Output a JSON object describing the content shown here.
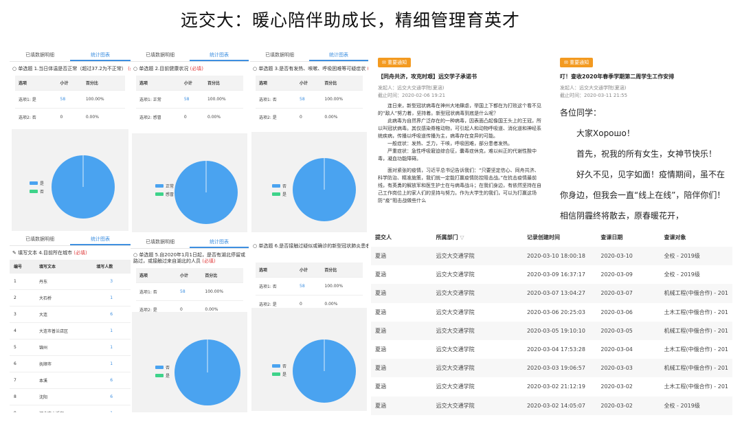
{
  "title": "远交大：暖心陪伴助成长，精细管理育英才",
  "tabs": {
    "detail": "已填数据明细",
    "stats": "统计图表"
  },
  "required_mark": "(必填)",
  "col_option": "选项",
  "col_subtotal": "小计",
  "col_percent": "百分比",
  "panels": [
    {
      "question": "单选题 1.当日体温是否正常（超过37.2为不正常）",
      "rows": [
        {
          "option": "选项1: 是",
          "count": "58",
          "percent": "100.00%"
        },
        {
          "option": "选项2: 否",
          "count": "0",
          "percent": "0.00%"
        }
      ],
      "legend": [
        "是",
        "否"
      ]
    },
    {
      "question": "单选题 2.目前健康状况",
      "rows": [
        {
          "option": "选项1: 正常",
          "count": "58",
          "percent": "100.00%"
        },
        {
          "option": "选项2: 感冒",
          "count": "0",
          "percent": "0.00%"
        }
      ],
      "legend": [
        "正常",
        "感冒"
      ]
    },
    {
      "question": "单选题 3.是否有发热、咳嗽、呼吸困难等可疑症状",
      "rows": [
        {
          "option": "选项1: 否",
          "count": "58",
          "percent": "100.00%"
        },
        {
          "option": "选项2: 是",
          "count": "0",
          "percent": "0.00%"
        }
      ],
      "legend": [
        "否",
        "是"
      ]
    },
    {
      "question": "单选题 5.自2020年1月1日起，是否有湖北停留或路过，或接触过来自湖北的人员",
      "rows": [
        {
          "option": "选项1: 否",
          "count": "58",
          "percent": "100.00%"
        },
        {
          "option": "选项2: 是",
          "count": "0",
          "percent": "0.00%"
        }
      ],
      "legend": [
        "否",
        "是"
      ]
    },
    {
      "question": "单选题 6.是否接触过疑似或确诊的新型冠状肺炎患者",
      "rows": [
        {
          "option": "选项1: 否",
          "count": "58",
          "percent": "100.00%"
        },
        {
          "option": "选项2: 是",
          "count": "0",
          "percent": "0.00%"
        }
      ],
      "legend": [
        "否",
        "是"
      ]
    }
  ],
  "city_panel": {
    "question": "填写文本 4.目前所在城市",
    "headers": [
      "编号",
      "填写文本",
      "填写人数"
    ],
    "rows": [
      [
        "1",
        "丹东",
        "3"
      ],
      [
        "2",
        "大石桥",
        "1"
      ],
      [
        "3",
        "大连",
        "6"
      ],
      [
        "4",
        "大连市普兰店区",
        "1"
      ],
      [
        "5",
        "锦州",
        "1"
      ],
      [
        "6",
        "抚顺市",
        "1"
      ],
      [
        "7",
        "本溪",
        "6"
      ],
      [
        "8",
        "沈阳",
        "6"
      ],
      [
        "9",
        "河北唐山迁安",
        "1"
      ]
    ]
  },
  "notice1": {
    "badge": "重要通知",
    "title": "【同舟共济，攻克时艰】远交学子承诺书",
    "sender": "发起人：远交大交通学院(夏涵)",
    "deadline": "截止时间：2020-02-06 19:21",
    "paragraphs": [
      "连日来，新型冠状病毒在神州大地肆虐，举国上下都在为打败这个看不见的“敌人”努力着，坚持着。新型冠状病毒到底是什么呢？",
      "此病毒为自然界广泛存在的一种病毒，因表面凸起像国王头上的王冠，所以叫冠状病毒。其仅感染脊椎动物，可引起人和动物呼吸道、消化道和神经系统疾病，传播以呼吸道传播为主，病毒存在变异的可能。",
      "一般症状：发热、乏力，干咳，呼吸困难，部分患者发热。",
      "严重症状：急性呼吸窘迫综合征，囊毒症休克，难以纠正的代谢性酸中毒，凝血功能障碍。",
      "面对紧张的疫情，习近平总书记告诉我们：“只要坚定信心、同舟共济、科学防治、精准施策，我们就一定能打赢疫情防控阻击战。”在抗击疫情最前线，有英勇的解放军和医生护士在与病毒战斗；在我们身边，有依然坚持在自己工作岗位上的家人们的坚持与努力。作为大学生的我们，可以为打赢这场防“疫”阻击战做些什么"
    ]
  },
  "notice2": {
    "badge": "重要通知",
    "title": "叮！查收2020年春季学期第二周学生工作安排",
    "sender": "发起人：远交大交通学院(夏涵)",
    "deadline": "截止时间：2020-03-11 21:55",
    "paragraphs": [
      "各位同学：",
      "大家Хорошо！",
      "首先，祝我的所有女生，女神节快乐！",
      "好久不见，见字如面！疫情期间，虽不在你身边，但我会一直“线上在线”，陪伴你们！相信阴霾终将散去，原春暖花开，"
    ]
  },
  "records": {
    "headers": [
      "提交人",
      "所属部门",
      "记录创建时间",
      "查课日期",
      "查课对象"
    ],
    "rows": [
      [
        "夏涵",
        "远交大交通学院",
        "2020-03-10 18:00:18",
        "2020-03-10",
        "全校 - 2019级"
      ],
      [
        "夏涵",
        "远交大交通学院",
        "2020-03-09 16:37:17",
        "2020-03-09",
        "全校 - 2019级"
      ],
      [
        "夏涵",
        "远交大交通学院",
        "2020-03-07 13:04:27",
        "2020-03-07",
        "机械工程(中俄合作) - 201"
      ],
      [
        "夏涵",
        "远交大交通学院",
        "2020-03-06 20:25:03",
        "2020-03-06",
        "土木工程(中俄合作) - 201"
      ],
      [
        "夏涵",
        "远交大交通学院",
        "2020-03-05 19:10:10",
        "2020-03-05",
        "机械工程(中俄合作) - 201"
      ],
      [
        "夏涵",
        "远交大交通学院",
        "2020-03-04 17:53:28",
        "2020-03-04",
        "土木工程(中俄合作) - 201"
      ],
      [
        "夏涵",
        "远交大交通学院",
        "2020-03-03 19:06:57",
        "2020-03-03",
        "机械工程(中俄合作) - 201"
      ],
      [
        "夏涵",
        "远交大交通学院",
        "2020-03-02 21:12:19",
        "2020-03-02",
        "土木工程(中俄合作) - 201"
      ],
      [
        "夏涵",
        "远交大交通学院",
        "2020-03-02 14:05:07",
        "2020-03-02",
        "全校 - 2019级"
      ]
    ]
  },
  "colors": {
    "accent": "#3d8fe0",
    "pie_blue": "#4aa3f0",
    "pie_green": "#3ed38a",
    "badge": "#f39a20"
  },
  "chart_data": [
    {
      "type": "pie",
      "categories": [
        "是",
        "否"
      ],
      "values": [
        58,
        0
      ]
    },
    {
      "type": "pie",
      "categories": [
        "正常",
        "感冒"
      ],
      "values": [
        58,
        0
      ]
    },
    {
      "type": "pie",
      "categories": [
        "否",
        "是"
      ],
      "values": [
        58,
        0
      ]
    },
    {
      "type": "pie",
      "categories": [
        "否",
        "是"
      ],
      "values": [
        58,
        0
      ]
    },
    {
      "type": "pie",
      "categories": [
        "否",
        "是"
      ],
      "values": [
        58,
        0
      ]
    }
  ]
}
